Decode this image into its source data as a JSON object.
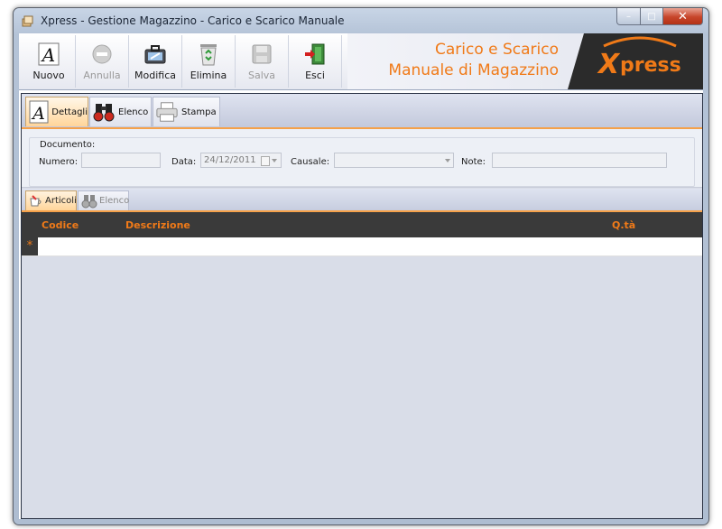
{
  "window": {
    "title": "Xpress - Gestione Magazzino - Carico e Scarico Manuale",
    "controls": {
      "minimize": "–",
      "maximize": "□",
      "close": "✕"
    }
  },
  "toolbar": {
    "buttons": [
      {
        "label": "Nuovo",
        "icon": "letter-a-icon",
        "enabled": true
      },
      {
        "label": "Annulla",
        "icon": "cancel-circle-icon",
        "enabled": false
      },
      {
        "label": "Modifica",
        "icon": "edit-briefcase-icon",
        "enabled": true
      },
      {
        "label": "Elimina",
        "icon": "recycle-bin-icon",
        "enabled": true
      },
      {
        "label": "Salva",
        "icon": "floppy-disk-icon",
        "enabled": false
      },
      {
        "label": "Esci",
        "icon": "exit-door-icon",
        "enabled": true
      }
    ]
  },
  "banner": {
    "line1": "Carico e Scarico",
    "line2": "Manuale di Magazzino",
    "logo_x": "X",
    "logo_rest": "press"
  },
  "tabs": [
    {
      "label": "Dettagli",
      "icon": "letter-a-icon",
      "active": true
    },
    {
      "label": "Elenco",
      "icon": "binoculars-icon",
      "active": false
    },
    {
      "label": "Stampa",
      "icon": "printer-icon",
      "active": false
    }
  ],
  "document": {
    "group_label": "Documento:",
    "numero_label": "Numero:",
    "numero_value": "",
    "data_label": "Data:",
    "data_value": "24/12/2011",
    "causale_label": "Causale:",
    "causale_value": "",
    "note_label": "Note:",
    "note_value": ""
  },
  "subtabs": [
    {
      "label": "Articoli",
      "icon": "cup-icon",
      "active": true
    },
    {
      "label": "Elenco",
      "icon": "binoculars-icon",
      "active": false
    }
  ],
  "grid": {
    "columns": [
      "Codice",
      "Descrizione",
      "Q.tà"
    ],
    "new_row_marker": "*"
  },
  "colors": {
    "accent_orange": "#f07a18",
    "grid_header": "#3a3a3a",
    "panel_bg": "#d9dde8"
  }
}
